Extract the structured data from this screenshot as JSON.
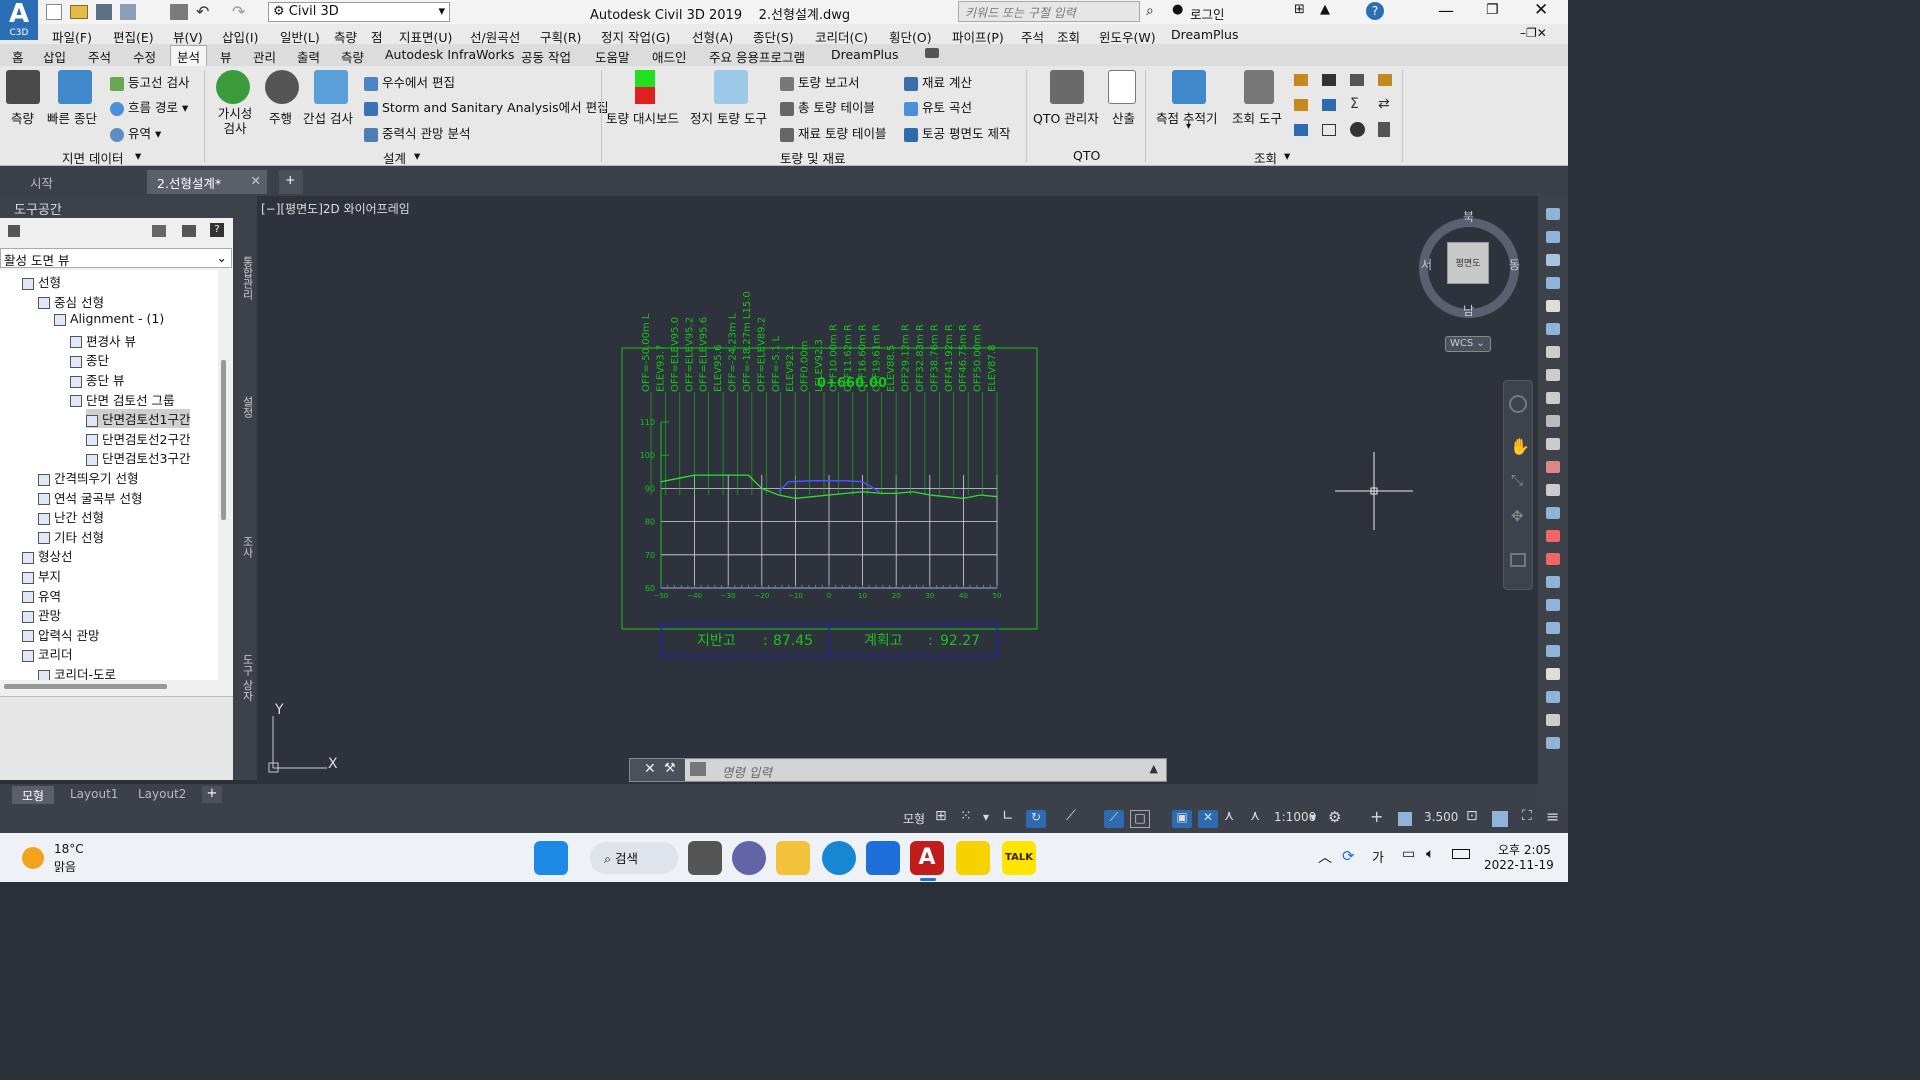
{
  "title": {
    "app_label": "Civil 3D",
    "title_text": "Autodesk Civil 3D 2019    2.선형설계.dwg",
    "search_placeholder": "키워드 또는 구절 입력",
    "login": "로그인",
    "app_letter": "A",
    "app_sub": "C3D"
  },
  "menu": [
    "파일(F)",
    "편집(E)",
    "뷰(V)",
    "삽입(I)",
    "일반(L)",
    "측량",
    "점",
    "지표면(U)",
    "선/원곡선",
    "구획(R)",
    "정지 작업(G)",
    "선형(A)",
    "종단(S)",
    "코리더(C)",
    "횡단(O)",
    "파이프(P)",
    "주석",
    "조회",
    "윈도우(W)",
    "DreamPlus"
  ],
  "ribbon_tabs": [
    "홈",
    "삽입",
    "주석",
    "수정",
    "분석",
    "뷰",
    "관리",
    "출력",
    "측량",
    "Autodesk InfraWorks",
    "공동 작업",
    "도움말",
    "애드인",
    "주요 응용프로그램",
    "DreamPlus"
  ],
  "ribbon_active_tab": "분석",
  "ribbon": {
    "survey": "측량",
    "quick_profile": "빠른 종단",
    "contour_check": "등고선 검사",
    "flow_path": "흐름 경로",
    "watershed": "유역",
    "group_ground": "지면 데이터",
    "sight_check": "가시성 검사",
    "drive": "주행",
    "interference": "간섭 검사",
    "storm_edit": "우수에서 편집",
    "storm_sanitary": "Storm and Sanitary Analysis에서 편집",
    "gravity_pipe": "중력식 관망 분석",
    "group_design": "설계",
    "earthwork_dashboard": "토량 대시보드",
    "grading_tool": "정지 토량 도구",
    "earthwork_report": "토량 보고서",
    "total_volume_table": "총 토량 테이블",
    "material_volume_table": "재료 토량 테이블",
    "material_calc": "재료 계산",
    "mass_haul": "유토 곡선",
    "earthwork_plan": "토공 평면도 제작",
    "group_volume": "토량 및 재료",
    "qto_manager": "QTO 관리자",
    "takeoff": "산출",
    "group_qto": "QTO",
    "tracker": "측점 추적기",
    "inquiry_tool": "조회 도구",
    "group_inquiry": "조회"
  },
  "doc_tabs": [
    "시작",
    "2.선형설계*"
  ],
  "toolspace": {
    "title": "도구공간",
    "view_select": "활성 도면 뷰",
    "side_tabs": [
      "통합관리",
      "설정",
      "조사",
      "도구 상자"
    ],
    "tree": [
      {
        "label": "선형",
        "depth": 1
      },
      {
        "label": "중심 선형",
        "depth": 2
      },
      {
        "label": "Alignment - (1)",
        "depth": 3
      },
      {
        "label": "편경사 뷰",
        "depth": 4
      },
      {
        "label": "종단",
        "depth": 4
      },
      {
        "label": "종단 뷰",
        "depth": 4
      },
      {
        "label": "단면 검토선 그룹",
        "depth": 4
      },
      {
        "label": "단면검토선1구간",
        "depth": 5
      },
      {
        "label": "단면검토선2구간",
        "depth": 5
      },
      {
        "label": "단면검토선3구간",
        "depth": 5
      },
      {
        "label": "간격띄우기 선형",
        "depth": 2
      },
      {
        "label": "연석 굴곡부 선형",
        "depth": 2
      },
      {
        "label": "난간 선형",
        "depth": 2
      },
      {
        "label": "기타 선형",
        "depth": 2
      },
      {
        "label": "형상선",
        "depth": 1
      },
      {
        "label": "부지",
        "depth": 1
      },
      {
        "label": "유역",
        "depth": 1
      },
      {
        "label": "관망",
        "depth": 1
      },
      {
        "label": "압력식 관망",
        "depth": 1
      },
      {
        "label": "코리더",
        "depth": 1
      },
      {
        "label": "코리더-도로",
        "depth": 2
      }
    ]
  },
  "viewport": {
    "label": "[−][평면도]2D 와이어프레임",
    "viewcube": {
      "top": "평면도",
      "north": "북",
      "south": "남",
      "east": "동",
      "west": "서",
      "wcs": "WCS"
    },
    "section": {
      "station": "0+660.00",
      "ground_label": "지반고",
      "ground_value": "87.45",
      "design_label": "계획고",
      "design_value": "92.27",
      "y_ticks": [
        "60",
        "70",
        "80",
        "90",
        "100",
        "110"
      ],
      "x_ticks": [
        "−50",
        "−40",
        "−30",
        "−20",
        "−10",
        "0",
        "10",
        "20",
        "30",
        "40",
        "50"
      ],
      "labels": [
        "OFF=-50.00m L",
        "ELEV93.7",
        "OFF=ELEV95.0",
        "OFF=ELEV95.2",
        "OFF=ELEV95.6",
        "ELEV95.6",
        "OFF=-24.23m L",
        "OFF=-18.27m L15.0",
        "OFF=ELEV89.2",
        "OFF=-5.1 L",
        "ELEV92.1",
        "OFF0.00m",
        "LELEV92.3",
        "OFF10.00m R",
        "OFF11.62m R",
        "OFF16.60m R",
        "OFF19.61m R",
        "ELEV88.5",
        "OFF29.12m R",
        "OFF32.83m R",
        "OFF38.76m R",
        "OFF41.92m R",
        "OFF46.75m R",
        "OFF50.00m R",
        "ELEV87.8"
      ],
      "ground_profile": [
        [
          -50,
          92
        ],
        [
          -45,
          93
        ],
        [
          -40,
          94
        ],
        [
          -35,
          94
        ],
        [
          -30,
          94
        ],
        [
          -24,
          94
        ],
        [
          -20,
          90
        ],
        [
          -15,
          88
        ],
        [
          -10,
          87
        ],
        [
          -5,
          87.5
        ],
        [
          0,
          88
        ],
        [
          5,
          88.5
        ],
        [
          10,
          89
        ],
        [
          16,
          88.5
        ],
        [
          20,
          88.5
        ],
        [
          25,
          89
        ],
        [
          30,
          88
        ],
        [
          35,
          87.5
        ],
        [
          40,
          87
        ],
        [
          45,
          88
        ],
        [
          50,
          87.5
        ]
      ],
      "design_profile": [
        [
          -15,
          89
        ],
        [
          -12,
          92
        ],
        [
          -5,
          92.3
        ],
        [
          0,
          92.3
        ],
        [
          5,
          92.3
        ],
        [
          10,
          92
        ],
        [
          15,
          89
        ]
      ]
    },
    "axis_x": "X",
    "axis_y": "Y",
    "command_placeholder": "명령 입력"
  },
  "layout_tabs": [
    "모형",
    "Layout1",
    "Layout2"
  ],
  "status": {
    "model": "모형",
    "scale": "1:1000",
    "value": "3.500"
  },
  "taskbar": {
    "temp": "18°C",
    "weather": "맑음",
    "search": "검색",
    "time": "오후 2:05",
    "date": "2022-11-19",
    "lang": "가"
  }
}
